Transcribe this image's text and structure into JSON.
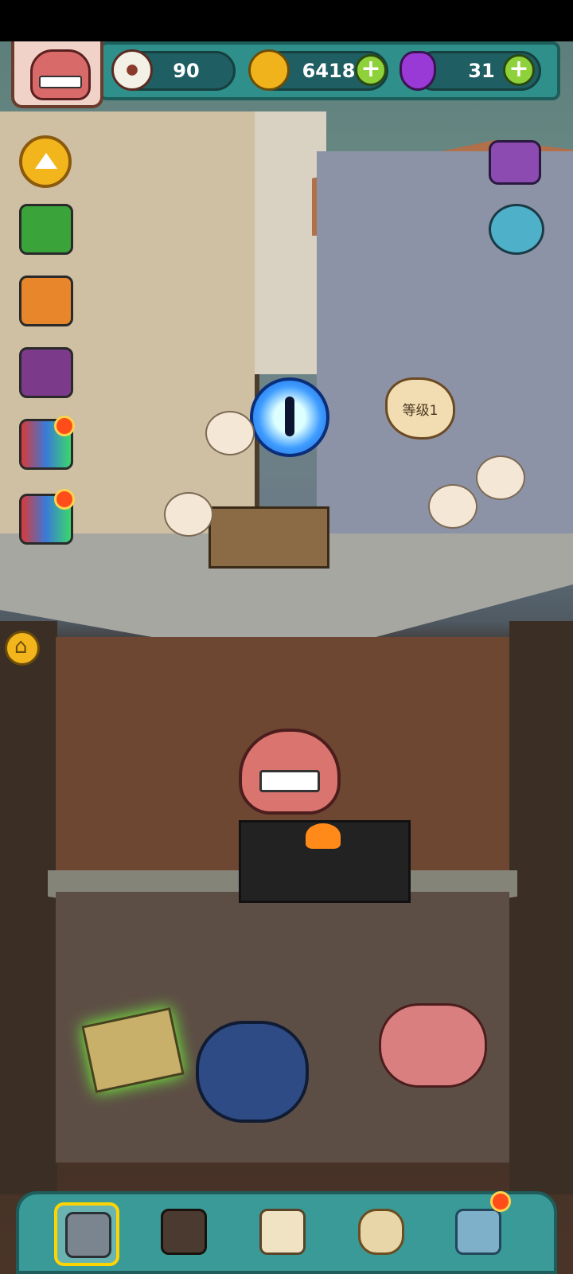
{
  "resources": {
    "eyeballs": "90",
    "coins": "6418",
    "potions": "31"
  },
  "level_badge": "等级1",
  "colors": {
    "topbar": "#2f8f8a",
    "bottombar": "#3a9a98",
    "plus": "#8fd13a",
    "notify": "#ff4d1a"
  },
  "icons": {
    "eyeball": "eyeball-icon",
    "coin": "coin-icon",
    "potion": "potion-icon",
    "plus": "plus-icon",
    "up": "arrow-up-icon",
    "home": "home-icon"
  }
}
